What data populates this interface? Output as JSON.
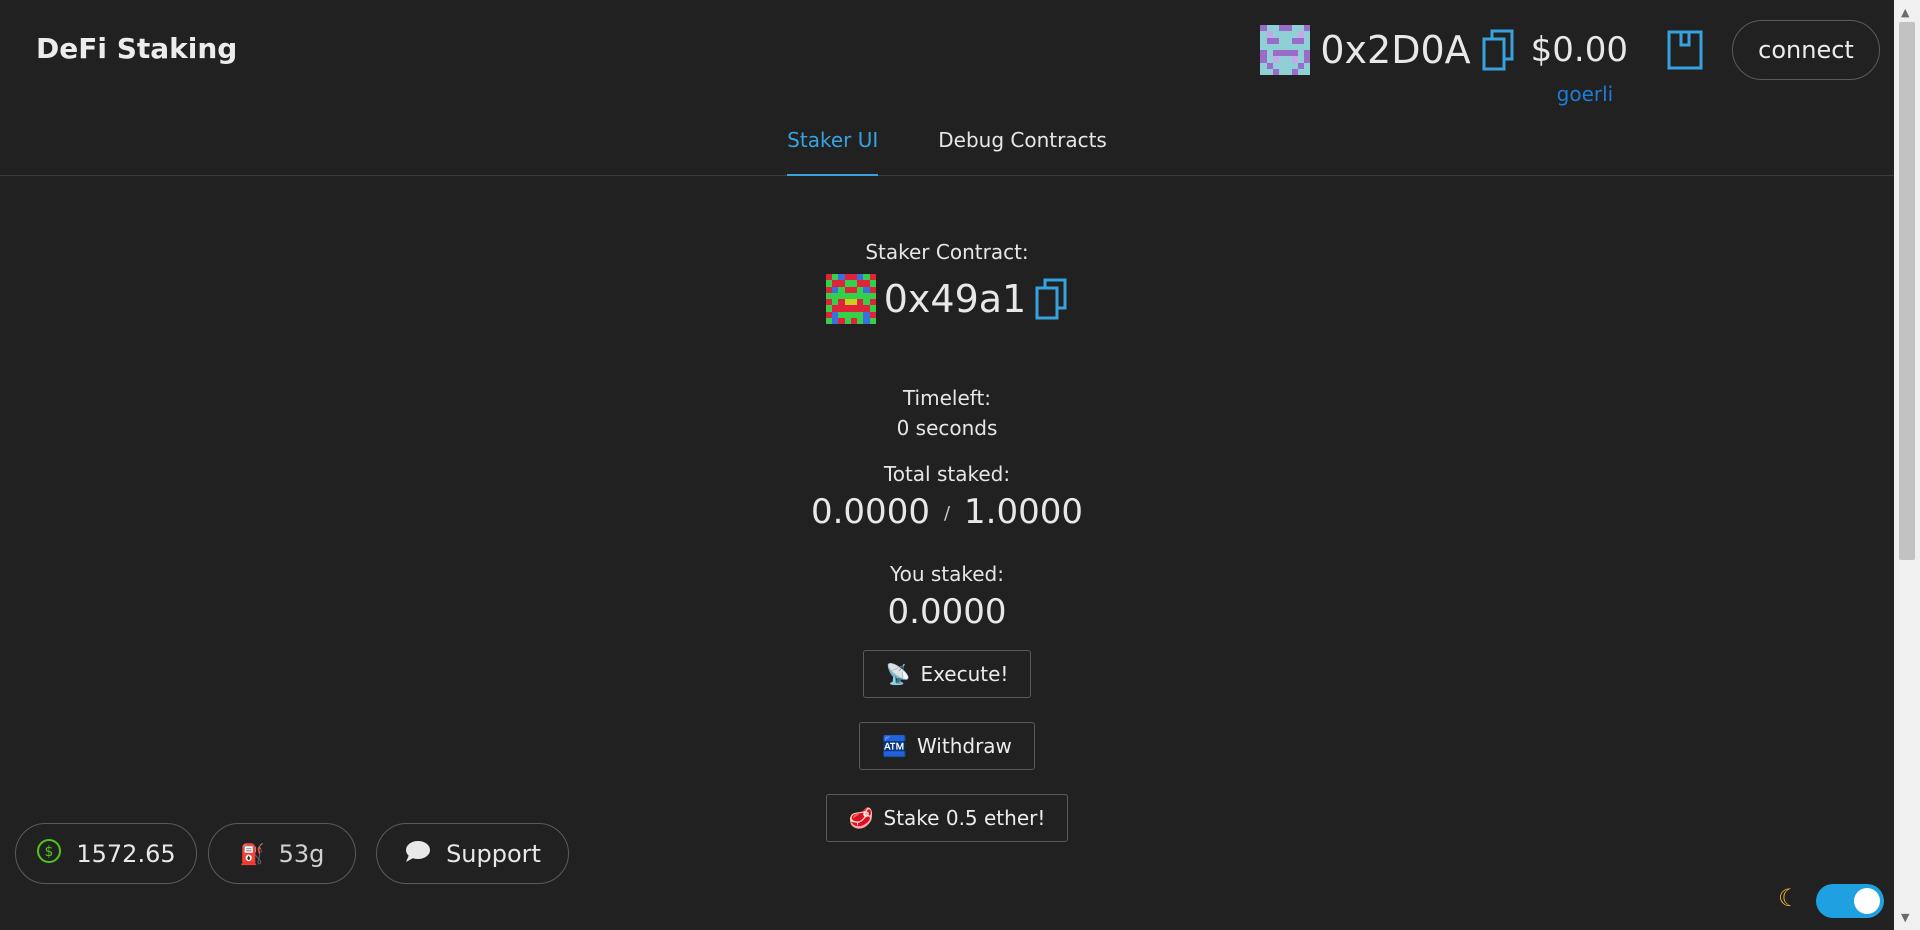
{
  "header": {
    "title": "DeFi Staking",
    "account": {
      "address": "0x2D0A",
      "balance": "$0.00",
      "network": "goerli",
      "connect_label": "connect"
    }
  },
  "tabs": [
    {
      "label": "Staker UI",
      "active": true
    },
    {
      "label": "Debug Contracts",
      "active": false
    }
  ],
  "main": {
    "contract_label": "Staker Contract:",
    "contract_address": "0x49a1",
    "timeleft_label": "Timeleft:",
    "timeleft_value": "0 seconds",
    "total_staked_label": "Total staked:",
    "total_staked": "0.0000",
    "threshold": "1.0000",
    "slash": "/",
    "you_staked_label": "You staked:",
    "you_staked": "0.0000",
    "execute_label": "Execute!",
    "withdraw_label": "Withdraw",
    "stake_label": "Stake 0.5 ether!"
  },
  "footer": {
    "price": "1572.65",
    "gas": "53g",
    "support_label": "Support"
  },
  "colors": {
    "background": "#212121",
    "accent": "#36a3e0",
    "network": "#1f7bd6",
    "toggle": "#1fa0e0"
  },
  "icons": {
    "copy": "copy-icon",
    "wallet": "wallet-icon",
    "price": "dollar-circle-icon",
    "gas": "fuel-pump-icon",
    "support": "chat-bubble-icon",
    "theme": "moon-icon"
  }
}
